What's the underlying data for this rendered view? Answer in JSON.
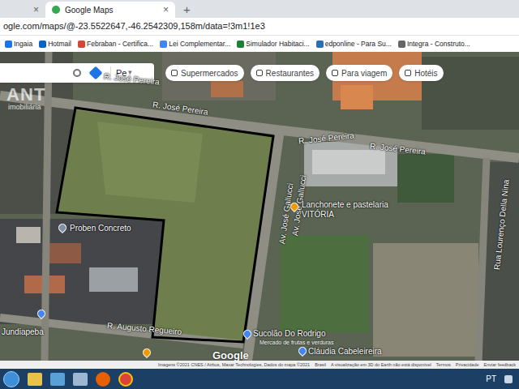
{
  "browser": {
    "tabs": [
      {
        "label": "",
        "close": "×",
        "selected": false
      },
      {
        "label": "Google Maps",
        "close": "×",
        "selected": true
      }
    ],
    "new_tab": "+",
    "address": "ogle.com/maps/@-23.5522647,-46.2542309,158m/data=!3m1!1e3",
    "bookmarks": [
      {
        "label": "Ingaia",
        "color": "#1a73e8"
      },
      {
        "label": "Hotmail",
        "color": "#0a64c8"
      },
      {
        "label": "Febraban - Certifica...",
        "color": "#d14836"
      },
      {
        "label": "Lei Complementar...",
        "color": "#4285f4"
      },
      {
        "label": "Simulador Habitaci...",
        "color": "#1e7f3a"
      },
      {
        "label": "edponline - Para Su...",
        "color": "#2a6fb5"
      },
      {
        "label": "Integra - Construto...",
        "color": "#666666"
      }
    ]
  },
  "map": {
    "search": {
      "value": "Pe",
      "caret": "▾"
    },
    "chips": [
      {
        "label": "Supermercados"
      },
      {
        "label": "Restaurantes"
      },
      {
        "label": "Para viagem"
      },
      {
        "label": "Hotéis"
      }
    ],
    "watermark": {
      "logo": "ANT",
      "sub": "imobiliária"
    },
    "labels": [
      {
        "text": "R. José Pereira",
        "kind": "street"
      },
      {
        "text": "R. José Pereira",
        "kind": "street"
      },
      {
        "text": "R. José Pereira",
        "kind": "street"
      },
      {
        "text": "R. José Pereira",
        "kind": "street"
      },
      {
        "text": "Av. José Gallucci",
        "kind": "street"
      },
      {
        "text": "Av. José Gallucci",
        "kind": "street"
      },
      {
        "text": "R. Augusto Regueiro",
        "kind": "street"
      },
      {
        "text": "Rua Lourenço Della Nina",
        "kind": "street"
      },
      {
        "text": "Lanchonete e pastelaria VITÓRIA",
        "kind": "place"
      },
      {
        "text": "Proben Concreto",
        "kind": "place"
      },
      {
        "text": "Jundiapeba",
        "kind": "place"
      },
      {
        "text": "Sucolão Do Rodrigo",
        "kind": "place"
      },
      {
        "text": "Mercado de frutas e verduras",
        "kind": "small"
      },
      {
        "text": "Cláudia Cabeleireira",
        "kind": "place"
      }
    ],
    "pins": [
      {
        "color": "#f29900"
      },
      {
        "color": "#7b8fa6"
      },
      {
        "color": "#4285f4"
      },
      {
        "color": "#4285f4"
      },
      {
        "color": "#4285f4"
      },
      {
        "color": "#f29900"
      }
    ],
    "logo": "Google",
    "footer": [
      "Imagens ©2021 CNES / Airbus, Maxar Technologies, Dados do mapa ©2021",
      "Brasil",
      "A visualização em 3D do Earth não está disponível",
      "Termos",
      "Privacidade",
      "Enviar feedback"
    ]
  },
  "taskbar": {
    "language": "PT"
  }
}
